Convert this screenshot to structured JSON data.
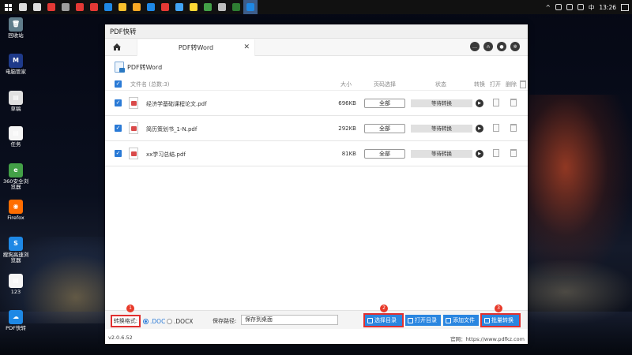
{
  "taskbar": {
    "icons": [
      {
        "name": "search-icon",
        "color": "#dddddd"
      },
      {
        "name": "task-view-icon",
        "color": "#dddddd"
      },
      {
        "name": "app-red-icon",
        "color": "#e53935"
      },
      {
        "name": "app-gray-icon",
        "color": "#9e9e9e"
      },
      {
        "name": "app-red2-icon",
        "color": "#e53935"
      },
      {
        "name": "mail-icon",
        "color": "#e53935"
      },
      {
        "name": "edge-icon",
        "color": "#1e88e5"
      },
      {
        "name": "chrome-icon",
        "color": "#fbc02d"
      },
      {
        "name": "folder-icon",
        "color": "#f9a825"
      },
      {
        "name": "app-blue-icon",
        "color": "#1e88e5"
      },
      {
        "name": "app-red3-icon",
        "color": "#e53935"
      },
      {
        "name": "app-blue2-icon",
        "color": "#42a5f5"
      },
      {
        "name": "app-yellow-icon",
        "color": "#fdd835"
      },
      {
        "name": "wechat-icon",
        "color": "#43a047"
      },
      {
        "name": "app-gray2-icon",
        "color": "#bdbdbd"
      },
      {
        "name": "excel-icon",
        "color": "#2e7d32"
      },
      {
        "name": "pdf-app-icon",
        "color": "#1e88e5"
      }
    ],
    "ime": "中",
    "time": "13:26"
  },
  "desktop": {
    "icons": [
      {
        "label": "回收站",
        "color": "#607d8b",
        "glyph": "🗑"
      },
      {
        "label": "电脑管家",
        "color": "#1e3a8a",
        "glyph": "M"
      },
      {
        "label": "草稿",
        "color": "#e0e0e0",
        "glyph": "▤"
      },
      {
        "label": "任务",
        "color": "#f5f5f5",
        "glyph": "▤"
      },
      {
        "label": "360安全浏览器",
        "color": "#43a047",
        "glyph": "e"
      },
      {
        "label": "Firefox",
        "color": "#ff6d00",
        "glyph": "◉"
      },
      {
        "label": "搜狗高速浏览器",
        "color": "#1e88e5",
        "glyph": "S"
      },
      {
        "label": "123",
        "color": "#f5f5f5",
        "glyph": "▤"
      },
      {
        "label": "PDF快转",
        "color": "#1e88e5",
        "glyph": "☁"
      }
    ]
  },
  "app": {
    "title": "PDF快转",
    "tab_label": "PDF转Word",
    "tab_close": "✕",
    "section_title": "PDF转Word",
    "columns": {
      "filename": "文件名 (总数:3)",
      "size": "大小",
      "page_select": "页码选择",
      "status": "状态",
      "convert": "转换",
      "open": "打开",
      "delete": "删除"
    },
    "files": [
      {
        "name": "经济学基础课程论文.pdf",
        "size": "696KB",
        "pages": "全部",
        "status": "等待转换"
      },
      {
        "name": "简历策划书_1-N.pdf",
        "size": "292KB",
        "pages": "全部",
        "status": "等待转换"
      },
      {
        "name": "xx学习总结.pdf",
        "size": "81KB",
        "pages": "全部",
        "status": "等待转换"
      }
    ],
    "bottom": {
      "format_label": "转换格式:",
      "format_options": [
        ".DOC",
        ".DOCX"
      ],
      "selected_format": ".DOC",
      "save_label": "保存路径:",
      "save_value": "保存到桌面",
      "buttons": {
        "choose_dir": "选择目录",
        "open_dir": "打开目录",
        "add_files": "添加文件",
        "batch_convert": "批量转换"
      },
      "badges": [
        "1",
        "2",
        "3"
      ]
    },
    "footer": {
      "version": "v2.0.6.52",
      "site": "官网：https://www.pdfkz.com"
    }
  },
  "colors": {
    "accent": "#2a86e0",
    "highlight": "#e03030"
  }
}
